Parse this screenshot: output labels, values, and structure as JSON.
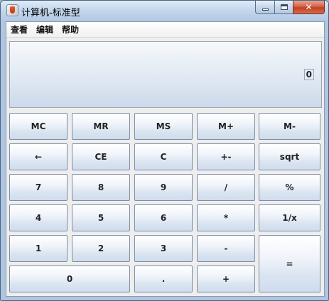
{
  "window": {
    "title": "计算机-标准型"
  },
  "menu": [
    "查看",
    "编辑",
    "帮助"
  ],
  "display": {
    "value": "0"
  },
  "buttons": {
    "mc": "MC",
    "mr": "MR",
    "ms": "MS",
    "mplus": "M+",
    "mminus": "M-",
    "back": "←",
    "ce": "CE",
    "c": "C",
    "sign": "+-",
    "sqrt": "sqrt",
    "n7": "7",
    "n8": "8",
    "n9": "9",
    "div": "/",
    "pct": "%",
    "n4": "4",
    "n5": "5",
    "n6": "6",
    "mul": "*",
    "inv": "1/x",
    "n1": "1",
    "n2": "2",
    "n3": "3",
    "sub": "-",
    "eq": "=",
    "n0": "0",
    "dot": ".",
    "add": "+"
  }
}
